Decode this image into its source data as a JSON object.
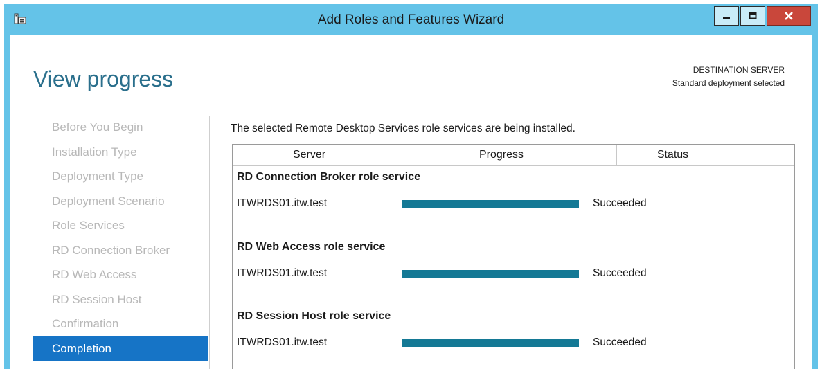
{
  "window": {
    "title": "Add Roles and Features Wizard",
    "app_icon": "server-manager-icon",
    "controls": [
      "minimize-icon",
      "maximize-icon",
      "close-icon"
    ],
    "accent": "#64c3e8",
    "close_color": "#c9473b"
  },
  "page": {
    "title": "View progress",
    "destination_label": "DESTINATION SERVER",
    "destination_value": "Standard deployment selected"
  },
  "nav": {
    "items": [
      {
        "label": "Before You Begin",
        "active": false
      },
      {
        "label": "Installation Type",
        "active": false
      },
      {
        "label": "Deployment Type",
        "active": false
      },
      {
        "label": "Deployment Scenario",
        "active": false
      },
      {
        "label": "Role Services",
        "active": false
      },
      {
        "label": "RD Connection Broker",
        "active": false
      },
      {
        "label": "RD Web Access",
        "active": false
      },
      {
        "label": "RD Session Host",
        "active": false
      },
      {
        "label": "Confirmation",
        "active": false
      },
      {
        "label": "Completion",
        "active": true
      }
    ],
    "active_color": "#1674c6"
  },
  "main": {
    "intro": "The selected Remote Desktop Services role services are being installed.",
    "columns": {
      "server": "Server",
      "progress": "Progress",
      "status": "Status",
      "extra": ""
    },
    "groups": [
      {
        "title": "RD Connection Broker role service",
        "server": "ITWRDS01.itw.test",
        "progress": 1.0,
        "status": "Succeeded"
      },
      {
        "title": "RD Web Access role service",
        "server": "ITWRDS01.itw.test",
        "progress": 1.0,
        "status": "Succeeded"
      },
      {
        "title": "RD Session Host role service",
        "server": "ITWRDS01.itw.test",
        "progress": 1.0,
        "status": "Succeeded"
      }
    ],
    "progress_color": "#147995"
  }
}
